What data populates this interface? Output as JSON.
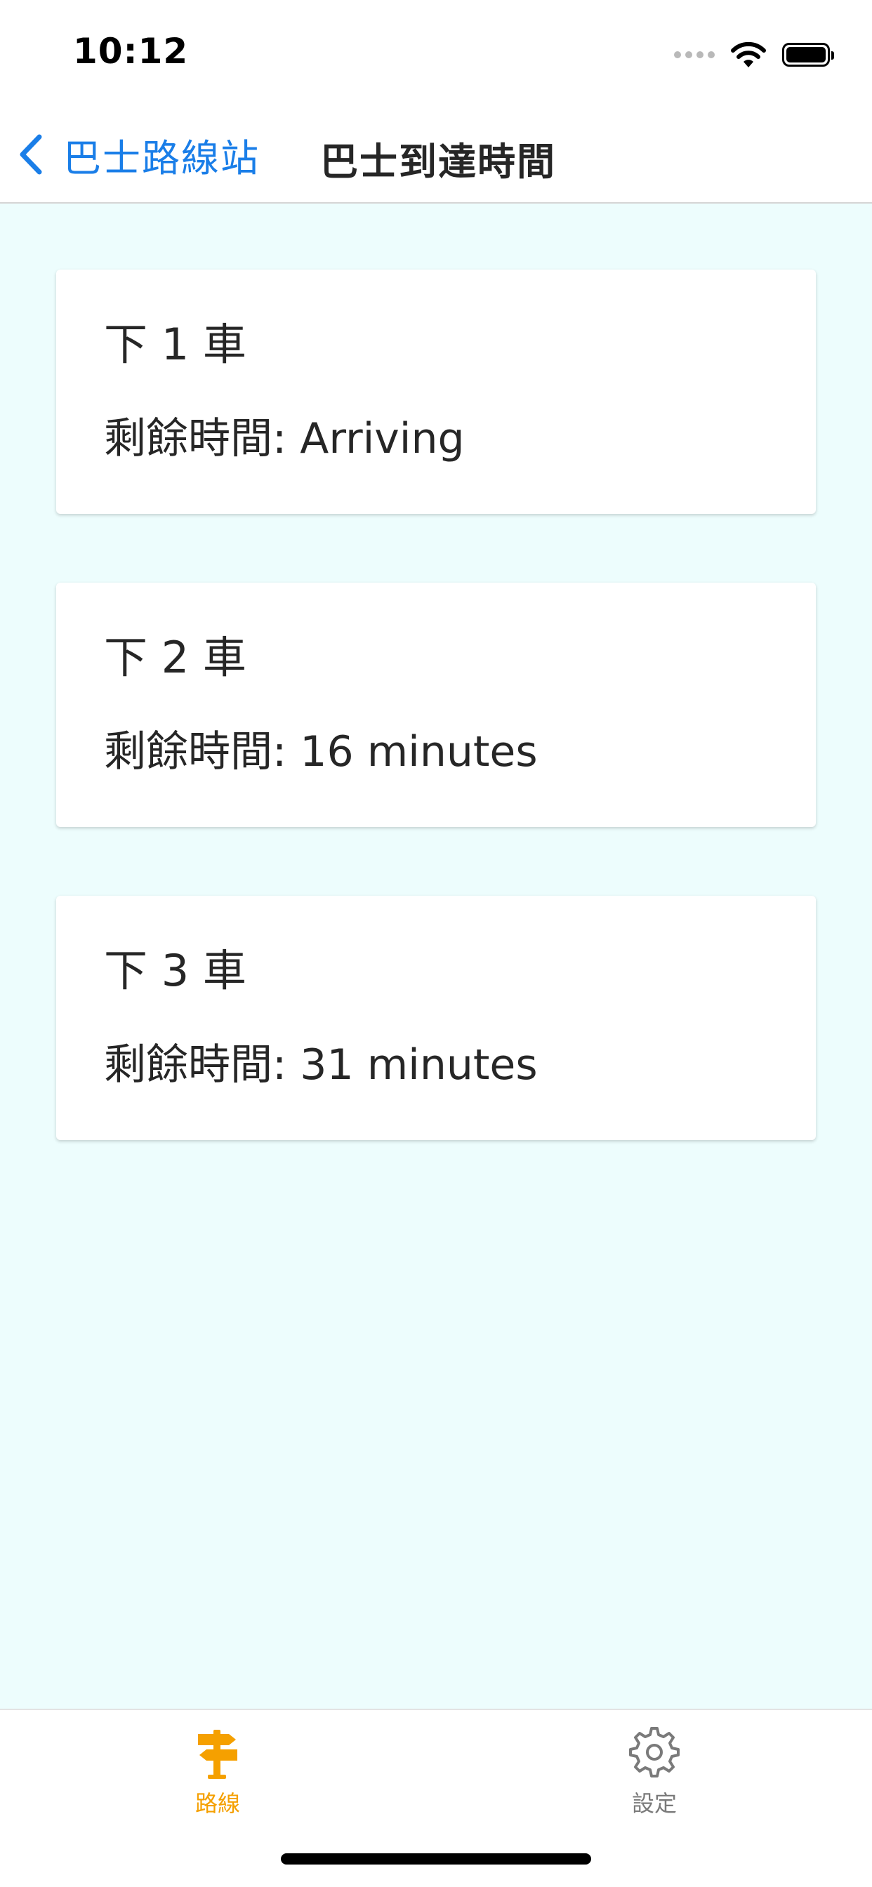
{
  "status_bar": {
    "time": "10:12"
  },
  "nav": {
    "back_label": "巴士路線站",
    "title": "巴士到達時間"
  },
  "arrivals": [
    {
      "title": "下 1 車",
      "remaining": "剩餘時間: Arriving"
    },
    {
      "title": "下 2 車",
      "remaining": "剩餘時間: 16 minutes"
    },
    {
      "title": "下 3 車",
      "remaining": "剩餘時間: 31 minutes"
    }
  ],
  "tab_bar": {
    "tabs": [
      {
        "label": "路線",
        "icon": "signpost-icon",
        "active": true
      },
      {
        "label": "設定",
        "icon": "gear-icon",
        "active": false
      }
    ]
  },
  "colors": {
    "accent": "#1a7ee8",
    "active_tab": "#f5a000",
    "inactive_tab": "#7a7a7a",
    "content_background": "#edfdfd"
  }
}
